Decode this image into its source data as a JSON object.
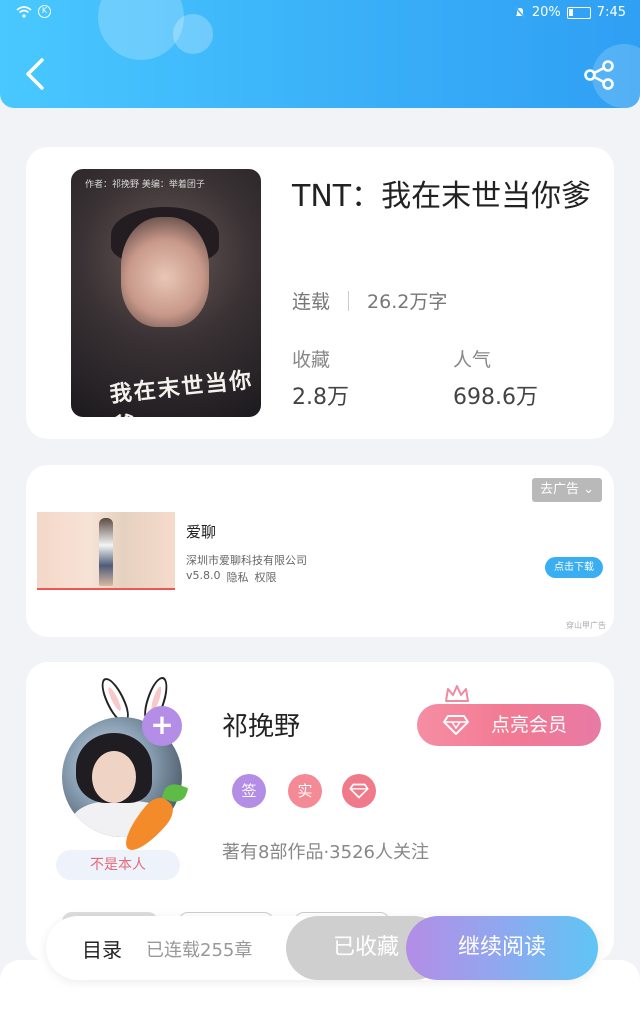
{
  "status_bar": {
    "battery": "20%",
    "time": "7:45"
  },
  "book": {
    "title": "TNT：我在末世当你爹",
    "status": "连载",
    "word_count": "26.2万字",
    "favorites_label": "收藏",
    "favorites_value": "2.8万",
    "popularity_label": "人气",
    "popularity_value": "698.6万",
    "cover": {
      "top_line": "作者：祁挽野    美编：举着团子",
      "title": "我在末世当你爹"
    }
  },
  "ad": {
    "remove_label": "去广告",
    "app_name": "爱聊",
    "company": "深圳市爱聊科技有限公司",
    "version": "v5.8.0",
    "privacy": "隐私",
    "permissions": "权限",
    "download_label": "点击下载",
    "source": "穿山甲广告"
  },
  "author": {
    "name": "祁挽野",
    "vip_label": "点亮会员",
    "badge_sign": "签",
    "badge_real": "实",
    "info": "著有8部作品·3526人关注",
    "not_me": "不是本人"
  },
  "bottom_bar": {
    "toc": "目录",
    "chapters": "已连载255章",
    "collected": "已收藏",
    "continue": "继续阅读"
  },
  "colors": {
    "header_start": "#49c8ff",
    "header_end": "#2f9ff3",
    "vip": "#f27a93",
    "purple": "#b48de6",
    "blue": "#3aaef0"
  }
}
